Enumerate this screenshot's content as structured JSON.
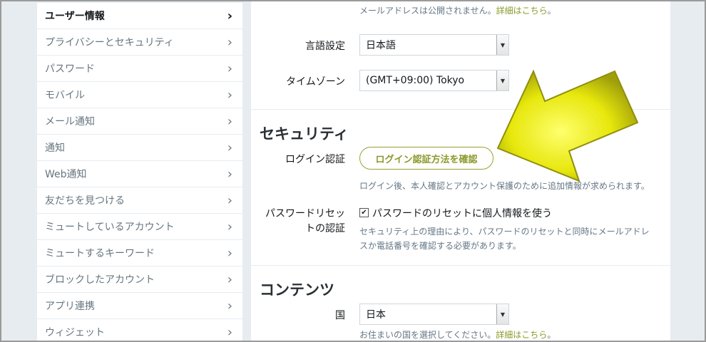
{
  "sidebar": {
    "items": [
      {
        "label": "ユーザー情報",
        "active": true
      },
      {
        "label": "プライバシーとセキュリティ"
      },
      {
        "label": "パスワード"
      },
      {
        "label": "モバイル"
      },
      {
        "label": "メール通知"
      },
      {
        "label": "通知"
      },
      {
        "label": "Web通知"
      },
      {
        "label": "友だちを見つける"
      },
      {
        "label": "ミュートしているアカウント"
      },
      {
        "label": "ミュートするキーワード"
      },
      {
        "label": "ブロックしたアカウント"
      },
      {
        "label": "アプリ連携"
      },
      {
        "label": "ウィジェット"
      }
    ],
    "chevron": "›"
  },
  "email_hint": {
    "text": "メールアドレスは公開されません。",
    "link": "詳細はこちら",
    "tail": "。"
  },
  "language": {
    "label": "言語設定",
    "value": "日本語"
  },
  "timezone": {
    "label": "タイムゾーン",
    "value": "(GMT+09:00) Tokyo"
  },
  "security": {
    "title": "セキュリティ",
    "login_label": "ログイン認証",
    "login_button": "ログイン認証方法を確認",
    "login_hint": "ログイン後、本人確認とアカウント保護のために追加情報が求められます。",
    "reset_label_line1": "パスワードリセッ",
    "reset_label_line2": "トの認証",
    "reset_checkbox_label": "パスワードのリセットに個人情報を使う",
    "reset_checked": true,
    "reset_hint_line1": "セキュリティ上の理由により、パスワードのリセットと同時にメールアドレ",
    "reset_hint_line2": "スか電話番号を確認する必要があります。"
  },
  "content": {
    "title": "コンテンツ",
    "country_label": "国",
    "country_value": "日本",
    "country_hint": "お住まいの国を選択してください。",
    "country_link": "詳細はこちら",
    "country_tail": "。"
  },
  "colors": {
    "arrow": "#e6e600",
    "link": "#8a9a2a",
    "background": "#e6ecf0"
  },
  "icons": {
    "chevron": "chevron-right-icon",
    "select_arrow": "triangle-down-icon",
    "check": "check-icon",
    "overlay": "yellow-arrow-icon"
  }
}
